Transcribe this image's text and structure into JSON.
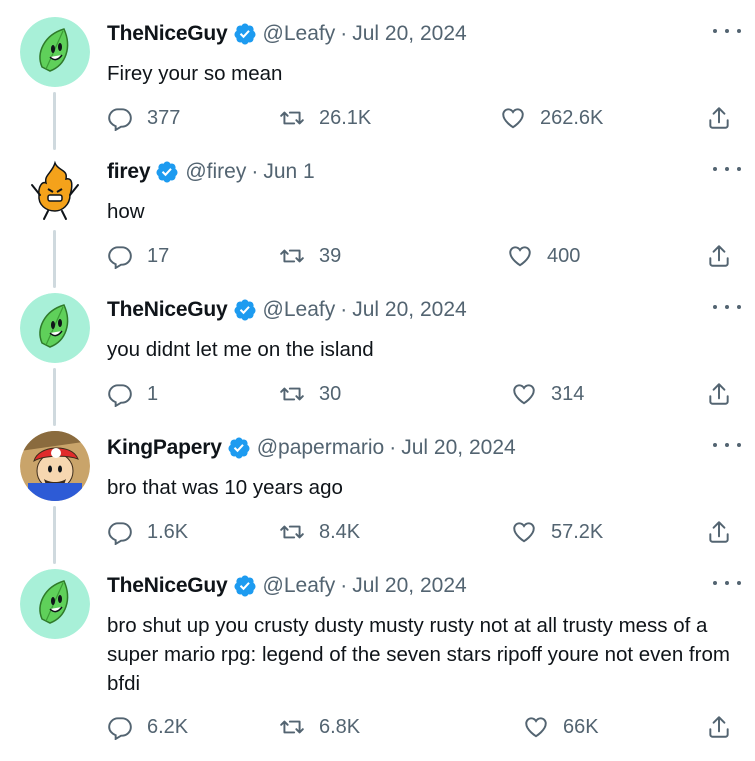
{
  "tweets": [
    {
      "name": "TheNiceGuy",
      "handle": "@Leafy",
      "date": "Jul 20, 2024",
      "text": "Firey your so mean",
      "replies": "377",
      "retweets": "26.1K",
      "likes": "262.6K",
      "avatar_icon": "leafy-avatar"
    },
    {
      "name": "firey",
      "handle": "@firey",
      "date": "Jun 1",
      "text": "how",
      "replies": "17",
      "retweets": "39",
      "likes": "400",
      "avatar_icon": "firey-avatar"
    },
    {
      "name": "TheNiceGuy",
      "handle": "@Leafy",
      "date": "Jul 20, 2024",
      "text": "you didnt let me on the island",
      "replies": "1",
      "retweets": "30",
      "likes": "314",
      "avatar_icon": "leafy-avatar"
    },
    {
      "name": "KingPapery",
      "handle": "@papermario",
      "date": "Jul 20, 2024",
      "text": "bro that was 10 years ago",
      "replies": "1.6K",
      "retweets": "8.4K",
      "likes": "57.2K",
      "avatar_icon": "paper-mario-avatar"
    },
    {
      "name": "TheNiceGuy",
      "handle": "@Leafy",
      "date": "Jul 20, 2024",
      "text": "bro shut up you crusty dusty musty rusty not at all trusty mess of a super mario rpg: legend of the seven stars ripoff youre not even from bfdi",
      "replies": "6.2K",
      "retweets": "6.8K",
      "likes": "66K",
      "avatar_icon": "leafy-avatar"
    }
  ],
  "separator": "·",
  "colors": {
    "text_primary": "#0f1419",
    "text_secondary": "#536471",
    "verified_blue": "#1d9bf0",
    "thread_line": "#cfd9de",
    "leafy_bg": "#a8f0d8",
    "leafy_leaf": "#5fd05a"
  }
}
